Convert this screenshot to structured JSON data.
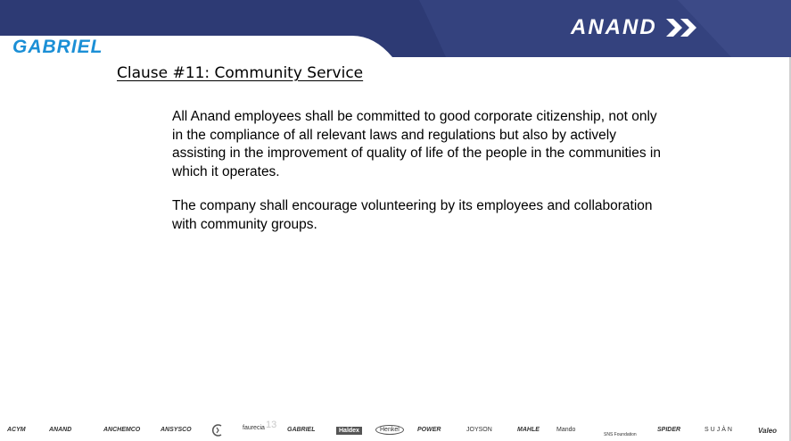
{
  "header": {
    "left_logo": "GABRIEL",
    "right_logo": "ANAND",
    "colors": {
      "band": "#2d3a74",
      "band_light": "#3c4a87",
      "gabriel_blue": "#1b8fd6"
    }
  },
  "slide": {
    "title": "Clause #11:  Community Service",
    "paragraphs": [
      "All Anand employees shall be committed to good corporate citizenship, not only in the compliance of all relevant laws and regulations but also by actively assisting in the improvement of quality of life of the people in the communities in which it operates.",
      "The company shall encourage volunteering by its employees and collaboration with community groups."
    ],
    "page_number": "13"
  },
  "footer": {
    "logos": [
      "ACYM",
      "ANAND",
      "ANCHEMCO",
      "ANSYSCO",
      "",
      "faurecia",
      "GABRIEL",
      "Haldex",
      "Henkel",
      "POWER",
      "JOYSON",
      "MAHLE",
      "Mando",
      "SNS Foundation",
      "SPIDER",
      "SUJÀN",
      "Valeo"
    ]
  }
}
